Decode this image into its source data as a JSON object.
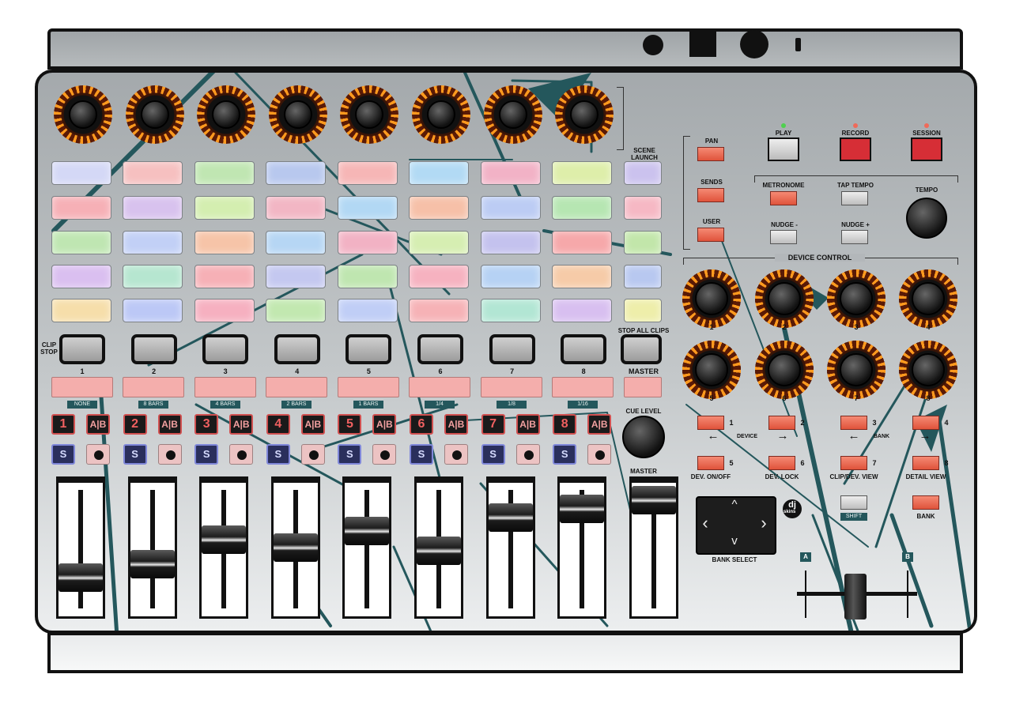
{
  "colors": {
    "panel": "#b7bbbe",
    "outline": "#111111",
    "deco_line": "#24575c",
    "button_red": "#e05a44",
    "led_orange": "#ff9a1e"
  },
  "pad_colors": [
    [
      "#d4d8f6",
      "#f6c0c0",
      "#c0e6b2",
      "#b8c8ee",
      "#f6b6b6",
      "#b2daf4",
      "#f2b2c6",
      "#deeeaa",
      "#cbc2ee"
    ],
    [
      "#f6b0b6",
      "#d8c2ee",
      "#d4eeb0",
      "#f2b6c4",
      "#b2d8f4",
      "#f6c0a8",
      "#bcccf4",
      "#b6e6b2",
      "#f6b8c4"
    ],
    [
      "#bfe6b2",
      "#c2d0f6",
      "#f6c4a8",
      "#b6d6f4",
      "#f2b2c4",
      "#d6eeb2",
      "#c4c2ee",
      "#f6a8aa",
      "#c2e6aa"
    ],
    [
      "#dabff0",
      "#b6e6d0",
      "#f6b0b6",
      "#c4c8f0",
      "#bfe6b0",
      "#f6b2c0",
      "#b6d2f4",
      "#f6cba8",
      "#b8c8f0"
    ],
    [
      "#f6deaa",
      "#bcc8f6",
      "#f6b0c0",
      "#c2e8b0",
      "#c0cef6",
      "#f6b2b6",
      "#b2e6d4",
      "#d8bff0",
      "#eeeeaa"
    ]
  ],
  "track_labels": [
    "1",
    "2",
    "3",
    "4",
    "5",
    "6",
    "7",
    "8"
  ],
  "clip_stop_label": "CLIP\nSTOP",
  "scene_launch_label": "SCENE\nLAUNCH",
  "stop_all_clips_label": "STOP ALL CLIPS",
  "master_label": "MASTER",
  "strip_tags": [
    "NONE",
    "8 BARS",
    "4 BARS",
    "2 BARS",
    "1 BARS",
    "1/4",
    "1/8",
    "1/16"
  ],
  "ab_label": "A|B",
  "solo_label": "S",
  "cue_level_label": "CUE LEVEL",
  "master_fader_label": "MASTER",
  "fader_levels": [
    0.72,
    0.6,
    0.38,
    0.45,
    0.3,
    0.48,
    0.18,
    0.1,
    0.02
  ],
  "mode_buttons": [
    "PAN",
    "SENDS",
    "USER"
  ],
  "transport": {
    "play": "PLAY",
    "record": "RECORD",
    "session": "SESSION",
    "metronome": "METRONOME",
    "tap_tempo": "TAP TEMPO",
    "nudge_minus": "NUDGE -",
    "nudge_plus": "NUDGE +",
    "tempo": "TEMPO"
  },
  "device_control_label": "DEVICE CONTROL",
  "device_knob_labels": [
    "1",
    "2",
    "3",
    "4",
    "5",
    "6",
    "7",
    "8"
  ],
  "device_buttons": {
    "numbers": [
      "1",
      "2",
      "3",
      "4",
      "5",
      "6",
      "7",
      "8"
    ],
    "device_label": "DEVICE",
    "bank_label": "BANK",
    "arrow_left": "←",
    "arrow_right": "→",
    "dev_on_off": "DEV. ON/OFF",
    "dev_lock": "DEV. LOCK",
    "clip_dev_view": "CLIP/DEV. VIEW",
    "detail_view": "DETAIL VIEW",
    "shift": "SHIFT",
    "bank": "BANK"
  },
  "bank_select": {
    "label": "BANK SELECT",
    "up": "^",
    "down": "v",
    "left": "‹",
    "right": "›"
  },
  "crossfader": {
    "a": "A",
    "b": "B"
  },
  "logo": {
    "dj": "dj",
    "skins": "skins"
  }
}
